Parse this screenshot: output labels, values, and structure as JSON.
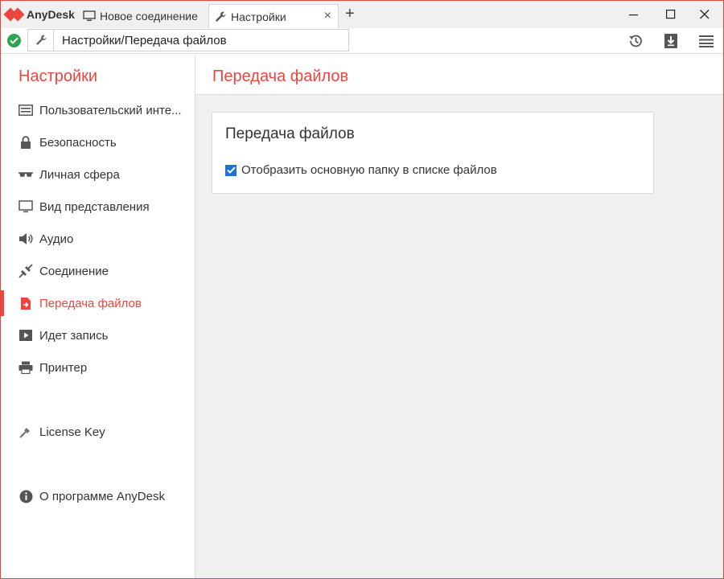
{
  "app": {
    "brand_name": "AnyDesk",
    "brand_color": "#ef443b"
  },
  "tabs": [
    {
      "label": "Новое соединение",
      "icon": "monitor-icon",
      "active": false
    },
    {
      "label": "Настройки",
      "icon": "wrench-icon",
      "active": true
    }
  ],
  "tab_controls": {
    "close": "×",
    "add": "+"
  },
  "window_controls": {
    "minimize": "—",
    "maximize": "☐",
    "close": "✕"
  },
  "address_bar": {
    "status": "connected",
    "status_color": "#2ea44f",
    "icon": "wrench-icon",
    "value": "Настройки/Передача файлов"
  },
  "toolbar": {
    "icons": [
      "history-icon",
      "download-icon",
      "menu-icon"
    ]
  },
  "sidebar": {
    "title": "Настройки",
    "items": [
      {
        "label": "Пользовательский инте...",
        "icon": "interface-icon",
        "active": false
      },
      {
        "label": "Безопасность",
        "icon": "lock-icon",
        "active": false
      },
      {
        "label": "Личная сфера",
        "icon": "glasses-icon",
        "active": false
      },
      {
        "label": "Вид представления",
        "icon": "monitor-icon",
        "active": false
      },
      {
        "label": "Аудио",
        "icon": "speaker-icon",
        "active": false
      },
      {
        "label": "Соединение",
        "icon": "connection-icon",
        "active": false
      },
      {
        "label": "Передача файлов",
        "icon": "file-transfer-icon",
        "active": true
      },
      {
        "label": "Идет запись",
        "icon": "recording-icon",
        "active": false
      },
      {
        "label": "Принтер",
        "icon": "printer-icon",
        "active": false
      }
    ],
    "license_item": {
      "label": "License Key",
      "icon": "key-icon"
    },
    "about_item": {
      "label": "О программе AnyDesk",
      "icon": "info-icon"
    }
  },
  "main": {
    "title": "Передача файлов",
    "card": {
      "title": "Передача файлов",
      "checkbox": {
        "label": "Отобразить основную папку в списке файлов",
        "checked": true
      }
    }
  }
}
